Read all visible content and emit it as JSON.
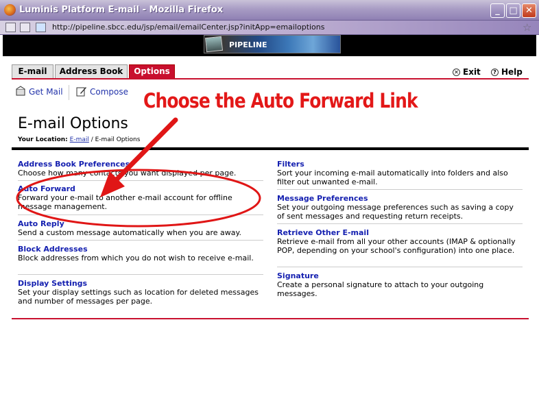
{
  "window": {
    "title": "Luminis Platform E-mail - Mozilla Firefox",
    "url": "http://pipeline.sbcc.edu/jsp/email/emailCenter.jsp?initApp=emailoptions"
  },
  "banner": {
    "logo_text": "PIPELINE"
  },
  "tabs": [
    {
      "label": "E-mail",
      "active": false
    },
    {
      "label": "Address Book",
      "active": false
    },
    {
      "label": "Options",
      "active": true
    }
  ],
  "utility": {
    "exit": "Exit",
    "help": "Help"
  },
  "toolbar": {
    "get_mail": "Get Mail",
    "compose": "Compose"
  },
  "page": {
    "title": "E-mail Options",
    "location_label": "Your Location:",
    "location_link": "E-mail",
    "location_sep": " / ",
    "location_current": "E-mail Options"
  },
  "options": {
    "left": [
      {
        "title": "Address Book Preferences",
        "desc": "Choose how many contacts you want displayed per page."
      },
      {
        "title": "Auto Forward",
        "desc": "Forward your e-mail to another e-mail account for offline message management."
      },
      {
        "title": "Auto Reply",
        "desc": "Send a custom message automatically when you are away."
      },
      {
        "title": "Block Addresses",
        "desc": "Block addresses from which you do not wish to receive e-mail."
      },
      {
        "title": "Display Settings",
        "desc": "Set your display settings such as location for deleted messages and number of messages per page."
      }
    ],
    "right": [
      {
        "title": "Filters",
        "desc": "Sort your incoming e-mail automatically into folders and also filter out unwanted e-mail."
      },
      {
        "title": "Message Preferences",
        "desc": "Set your outgoing message preferences such as saving a copy of sent messages and requesting return receipts."
      },
      {
        "title": "Retrieve Other E-mail",
        "desc": "Retrieve e-mail from all your other accounts (IMAP & optionally POP, depending on your school's configuration) into one place."
      },
      {
        "title": "Signature",
        "desc": "Create a personal signature to attach to your outgoing messages."
      }
    ]
  },
  "annotation": {
    "text": "Choose the Auto Forward Link",
    "color": "#e31818"
  },
  "colors": {
    "accent": "#c8102e",
    "link": "#1520b0"
  }
}
